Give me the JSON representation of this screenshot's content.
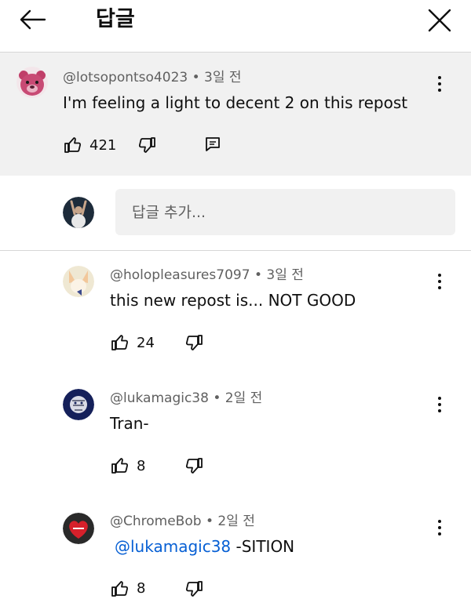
{
  "header": {
    "title": "답글"
  },
  "parent_comment": {
    "author": "@lotsopontso4023",
    "time": "3일 전",
    "text": "I'm feeling a light to decent 2 on this repost",
    "likes": "421"
  },
  "reply_input": {
    "placeholder": "답글 추가..."
  },
  "replies": [
    {
      "author": "@holopleasures7097",
      "time": "3일 전",
      "text": "this new repost is... NOT GOOD",
      "likes": "24"
    },
    {
      "author": "@lukamagic38",
      "time": "2일 전",
      "text": "Tran-",
      "likes": "8"
    },
    {
      "author": "@ChromeBob",
      "time": "2일 전",
      "mention": "@lukamagic38",
      "text": " -SITION",
      "likes": "8"
    }
  ],
  "colors": {
    "accent_link": "#065fd4",
    "meta_gray": "#606060",
    "parent_bg": "#f1f1f1"
  },
  "icons": [
    "back-arrow-icon",
    "close-icon",
    "thumb-up-icon",
    "thumb-down-icon",
    "reply-icon",
    "more-vert-icon"
  ]
}
